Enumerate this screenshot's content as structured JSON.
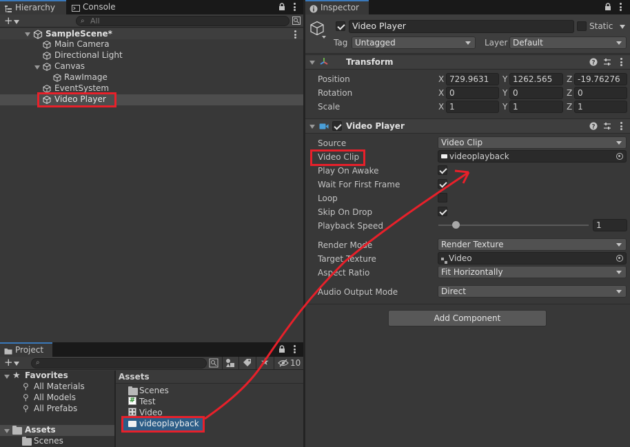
{
  "hierarchy": {
    "tab_label": "Hierarchy",
    "console_tab_label": "Console",
    "search_placeholder": "All",
    "scene_name": "SampleScene*",
    "items": [
      {
        "label": "Main Camera"
      },
      {
        "label": "Directional Light"
      },
      {
        "label": "Canvas"
      },
      {
        "label": "RawImage"
      },
      {
        "label": "EventSystem"
      },
      {
        "label": "Video Player"
      }
    ]
  },
  "project": {
    "tab_label": "Project",
    "hidden_count": "10",
    "favorites_label": "Favorites",
    "favorites": [
      "All Materials",
      "All Models",
      "All Prefabs"
    ],
    "assets_label": "Assets",
    "tree_scenes": "Scenes",
    "assets_header": "Assets",
    "assets": [
      "Scenes",
      "Test",
      "Video",
      "videoplayback"
    ]
  },
  "inspector": {
    "tab_label": "Inspector",
    "object_name": "Video Player",
    "static_label": "Static",
    "tag_label": "Tag",
    "tag_value": "Untagged",
    "layer_label": "Layer",
    "layer_value": "Default",
    "transform": {
      "title": "Transform",
      "position_label": "Position",
      "rotation_label": "Rotation",
      "scale_label": "Scale",
      "position": {
        "x": "729.9631",
        "y": "1262.565",
        "z": "-19.76276"
      },
      "rotation": {
        "x": "0",
        "y": "0",
        "z": "0"
      },
      "scale": {
        "x": "1",
        "y": "1",
        "z": "1"
      },
      "axis_x": "X",
      "axis_y": "Y",
      "axis_z": "Z"
    },
    "video_player": {
      "title": "Video Player",
      "source_label": "Source",
      "source_value": "Video Clip",
      "clip_label": "Video Clip",
      "clip_value": "videoplayback",
      "play_on_awake_label": "Play On Awake",
      "play_on_awake": true,
      "wait_first_frame_label": "Wait For First Frame",
      "wait_first_frame": true,
      "loop_label": "Loop",
      "loop": false,
      "skip_on_drop_label": "Skip On Drop",
      "skip_on_drop": true,
      "playback_speed_label": "Playback Speed",
      "playback_speed": "1",
      "render_mode_label": "Render Mode",
      "render_mode_value": "Render Texture",
      "target_texture_label": "Target Texture",
      "target_texture_value": "Video",
      "aspect_ratio_label": "Aspect Ratio",
      "aspect_ratio_value": "Fit Horizontally",
      "audio_output_label": "Audio Output Mode",
      "audio_output_value": "Direct"
    },
    "add_component_label": "Add Component"
  },
  "colors": {
    "highlight": "#e8202a",
    "tab_accent": "#3a79bb",
    "panel_bg": "#383838"
  }
}
